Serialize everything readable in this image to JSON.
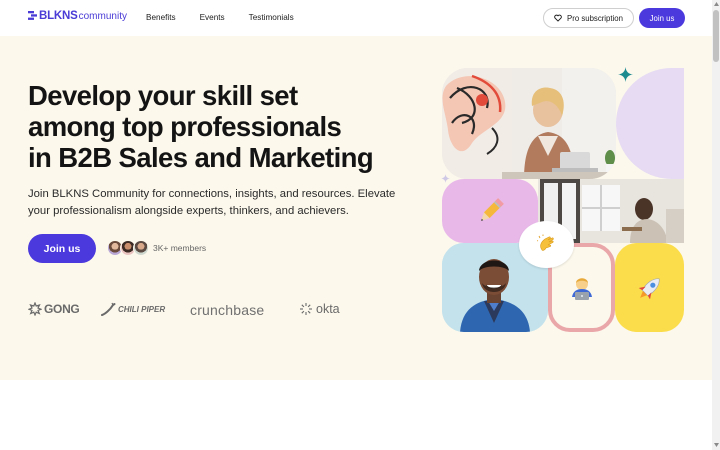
{
  "nav": {
    "logo_main": "BLKNS",
    "logo_sub": "community",
    "links": [
      "Benefits",
      "Events",
      "Testimonials"
    ],
    "pro_label": "Pro subscription",
    "join_label": "Join us"
  },
  "hero": {
    "headline_lines": [
      "Develop your skill set",
      "among top professionals",
      "in B2B Sales and Marketing"
    ],
    "subtitle": "Join BLKNS Community for connections, insights, and resources. Elevate your professionalism alongside experts, thinkers, and achievers.",
    "cta_label": "Join us",
    "members_label": "3K+ members"
  },
  "partners": {
    "gong": "GONG",
    "chili": "CHILI PIPER",
    "crunchbase": "crunchbase",
    "okta": "okta"
  },
  "collage": {
    "emojis": [
      "pencil",
      "clapping-hands",
      "technologist",
      "rocket"
    ]
  },
  "colors": {
    "accent": "#4c39dd",
    "hero_bg": "#fcf8ec",
    "lavender": "#e6dbf3",
    "pink": "#e8b8e9",
    "yellow": "#fbdd4c",
    "teal": "#1c8b8f"
  }
}
